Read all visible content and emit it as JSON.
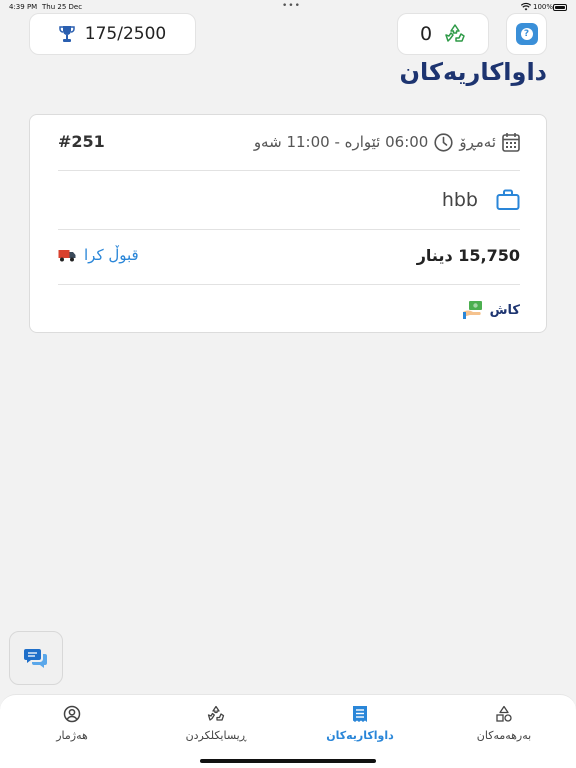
{
  "status_bar": {
    "time": "4:39 PM",
    "date": "Thu 25 Dec",
    "dots": "•••",
    "battery": "100%"
  },
  "header": {
    "score": "175/2500",
    "points": "0",
    "help_icon": "question-icon",
    "title": "داواکاریەکان"
  },
  "order": {
    "id": "#251",
    "day": "ئەمڕۆ",
    "time_range": "06:00 ئێوارە - 11:00 شەو",
    "item": "hbb",
    "price": "15,750 دینار",
    "status": "قبوڵ کرا",
    "payment": "کاش"
  },
  "tabs": [
    {
      "label": "هەژمار",
      "icon": "profile-icon",
      "active": false
    },
    {
      "label": "ڕیسایکلکردن",
      "icon": "recycle-icon",
      "active": false
    },
    {
      "label": "داواکاریەکان",
      "icon": "orders-icon",
      "active": true
    },
    {
      "label": "بەرهەمەکان",
      "icon": "products-icon",
      "active": false
    }
  ],
  "colors": {
    "accent": "#2a86d8",
    "title": "#1d3470",
    "background": "#f2f2f2",
    "recycle_green": "#2e9a47"
  }
}
